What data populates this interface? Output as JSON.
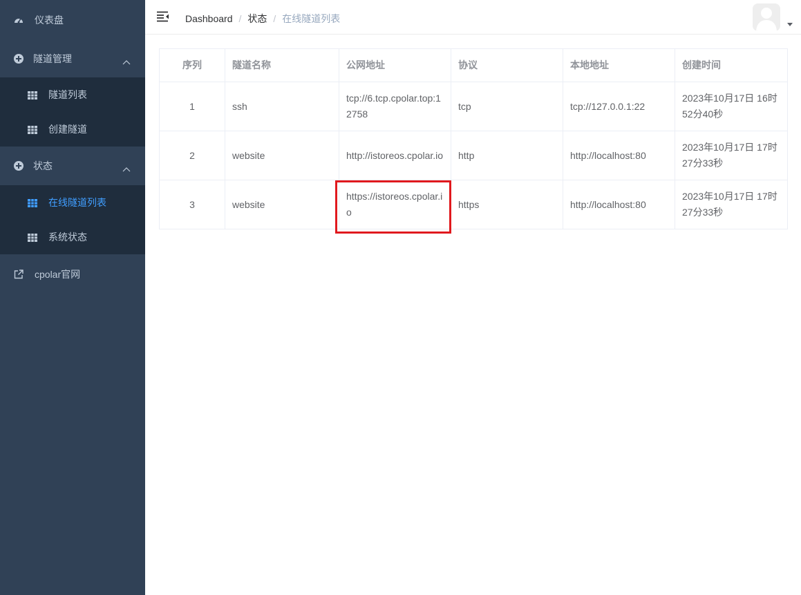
{
  "sidebar": {
    "dashboard": {
      "label": "仪表盘",
      "icon": "dashboard-icon"
    },
    "tunnel_mgmt": {
      "label": "隧道管理",
      "icon": "circle-plus-icon",
      "items": [
        {
          "label": "隧道列表",
          "icon": "table-icon"
        },
        {
          "label": "创建隧道",
          "icon": "table-icon"
        }
      ]
    },
    "status": {
      "label": "状态",
      "icon": "circle-plus-icon",
      "items": [
        {
          "label": "在线隧道列表",
          "icon": "table-icon",
          "active": true
        },
        {
          "label": "系统状态",
          "icon": "table-icon"
        }
      ]
    },
    "website": {
      "label": "cpolar官网",
      "icon": "external-link-icon"
    },
    "colors": {
      "bg": "#304156",
      "submenu_bg": "#1f2d3d",
      "text": "#bfcbd9",
      "active": "#409eff"
    }
  },
  "navbar": {
    "breadcrumb": [
      "Dashboard",
      "状态",
      "在线隧道列表"
    ],
    "separator": "/"
  },
  "table": {
    "headers": [
      "序列",
      "隧道名称",
      "公网地址",
      "协议",
      "本地地址",
      "创建时间"
    ],
    "rows": [
      [
        "1",
        "ssh",
        "tcp://6.tcp.cpolar.top:12758",
        "tcp",
        "tcp://127.0.0.1:22",
        "2023年10月17日 16时52分40秒"
      ],
      [
        "2",
        "website",
        "http://istoreos.cpolar.io",
        "http",
        "http://localhost:80",
        "2023年10月17日 17时27分33秒"
      ],
      [
        "3",
        "website",
        "https://istoreos.cpolar.io",
        "https",
        "http://localhost:80",
        "2023年10月17日 17时27分33秒"
      ]
    ]
  },
  "highlight_color": "#e0191e"
}
